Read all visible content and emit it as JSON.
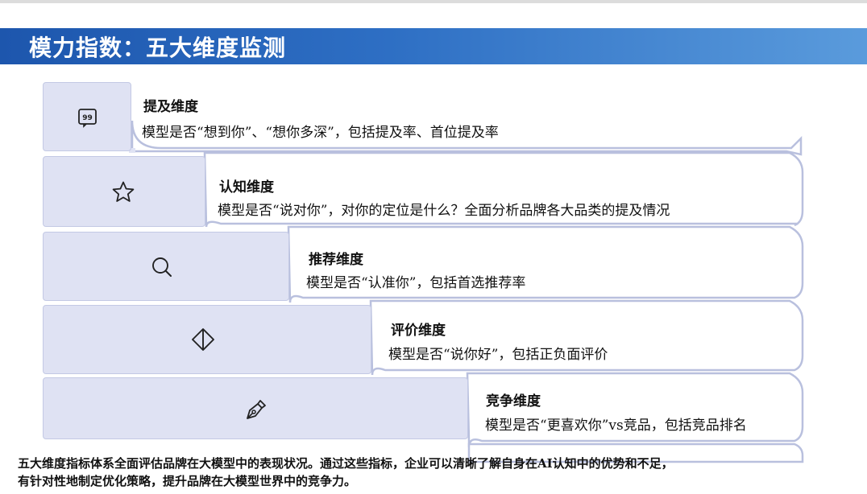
{
  "title": "模力指数：五大维度监测",
  "dimensions": [
    {
      "icon": "quote-icon",
      "heading": "提及维度",
      "description": "模型是否“想到你”、“想你多深”，包括提及率、首位提及率"
    },
    {
      "icon": "star-icon",
      "heading": "认知维度",
      "description": "模型是否“说对你”，对你的定位是什么？全面分析品牌各大品类的提及情况"
    },
    {
      "icon": "search-icon",
      "heading": "推荐维度",
      "description": "模型是否“认准你”，包括首选推荐率"
    },
    {
      "icon": "diamond-icon",
      "heading": "评价维度",
      "description": "模型是否“说你好”，包括正负面评价"
    },
    {
      "icon": "pen-icon",
      "heading": "竞争维度",
      "description": "模型是否“更喜欢你”vs竞品，包括竞品排名"
    }
  ],
  "summary": {
    "line1": "五大维度指标体系全面评估品牌在大模型中的表现状况。通过这些指标，企业可以清晰了解自身在AI认知中的优势和不足，",
    "line2": "有针对性地制定优化策略，提升品牌在大模型世界中的竞争力。"
  },
  "colors": {
    "title_bar_start": "#1d56ad",
    "title_bar_end": "#5a9bdc",
    "card_fill": "#dfe2f3",
    "panel_border": "#b9c0de"
  }
}
